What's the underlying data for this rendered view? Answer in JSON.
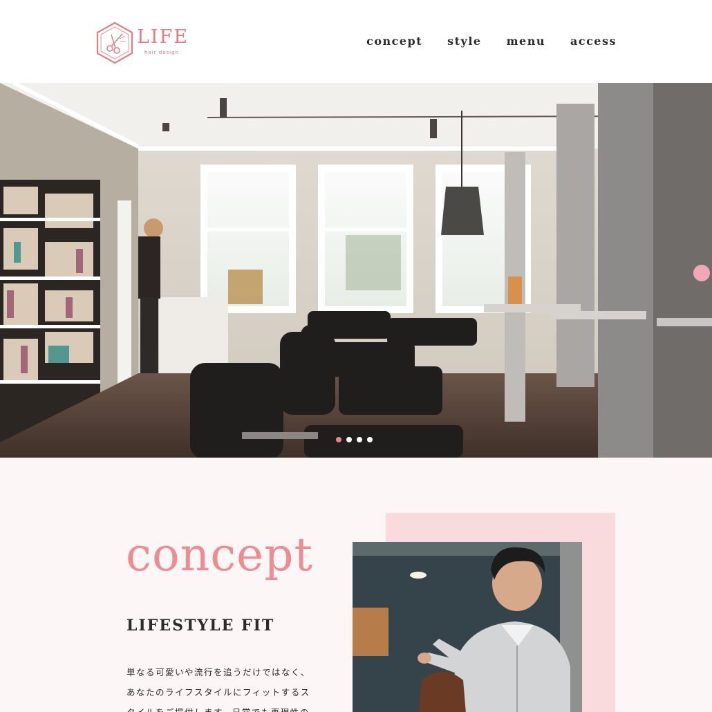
{
  "header": {
    "logo": {
      "word": "LIFE",
      "sub": "hair design",
      "icon": "scissors-hexagon-icon"
    },
    "nav": [
      "concept",
      "style",
      "menu",
      "access"
    ]
  },
  "hero": {
    "image": "hair-salon-interior",
    "slider": {
      "total": 4,
      "active": 1
    }
  },
  "concept": {
    "heading": "concept",
    "subheading": "LIFESTYLE FIT",
    "body": "単なる可愛いや流行を追うだけではなく、あなたのライフスタイルにフィットするスタイルをご提供します。日常でも再現性の",
    "photo": "stylist-cutting-hair"
  },
  "colors": {
    "accent": "#ec8d93",
    "pink_block": "#f9dadd",
    "section_bg": "#fdf6f6",
    "text": "#2b2b2b"
  }
}
